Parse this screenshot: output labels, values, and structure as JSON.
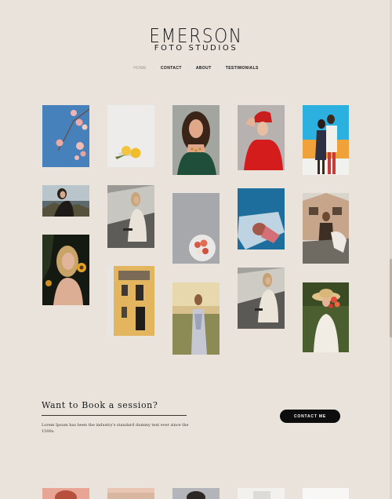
{
  "brand": {
    "title": "EMERSON",
    "subtitle": "FOTO STUDIOS"
  },
  "nav": {
    "items": [
      "HOME",
      "CONTACT",
      "ABOUT",
      "TESTIMONIALS"
    ]
  },
  "gallery": {
    "photos": [
      {
        "name": "photo-pink-blossoms",
        "subject": "pink blossoms against blue sky"
      },
      {
        "name": "photo-lemons",
        "subject": "lemons on white table"
      },
      {
        "name": "photo-woman-green-dress",
        "subject": "woman in green dress with necklace"
      },
      {
        "name": "photo-woman-red-hat",
        "subject": "woman in red hat and top"
      },
      {
        "name": "photo-two-women-orange",
        "subject": "two women on orange backdrop"
      },
      {
        "name": "photo-woman-seaside",
        "subject": "woman by the sea"
      },
      {
        "name": "photo-woman-rocks",
        "subject": "woman sitting on rocks"
      },
      {
        "name": "photo-fruit-plate",
        "subject": "plate of fruit on grey table"
      },
      {
        "name": "photo-woman-plastic-sheet",
        "subject": "woman under clear sheet on blue"
      },
      {
        "name": "photo-woman-horse",
        "subject": "woman with horse near house"
      },
      {
        "name": "photo-woman-sunflower",
        "subject": "blonde woman with sunflowers"
      },
      {
        "name": "photo-yellow-building",
        "subject": "yellow building facade"
      },
      {
        "name": "photo-woman-field",
        "subject": "woman in golden field"
      },
      {
        "name": "photo-woman-rocks-2",
        "subject": "woman sitting on rocks in white dress"
      },
      {
        "name": "photo-woman-straw-hat",
        "subject": "woman in straw hat with flowers"
      },
      {
        "name": "photo-bottom-1",
        "subject": "partial photo"
      },
      {
        "name": "photo-bottom-2",
        "subject": "partial photo"
      },
      {
        "name": "photo-bottom-3",
        "subject": "partial photo"
      },
      {
        "name": "photo-bottom-4",
        "subject": "partial photo"
      },
      {
        "name": "photo-bottom-5",
        "subject": "partial photo"
      }
    ]
  },
  "cta": {
    "heading": "Want to Book a session?",
    "text": "Lorem Ipsum has been the industry's standard dummy text ever since the 1500s.",
    "button_label": "CONTACT ME"
  },
  "colors": {
    "background": "#e9e3dc",
    "button": "#0d0d0d",
    "text": "#1a1a1a"
  }
}
